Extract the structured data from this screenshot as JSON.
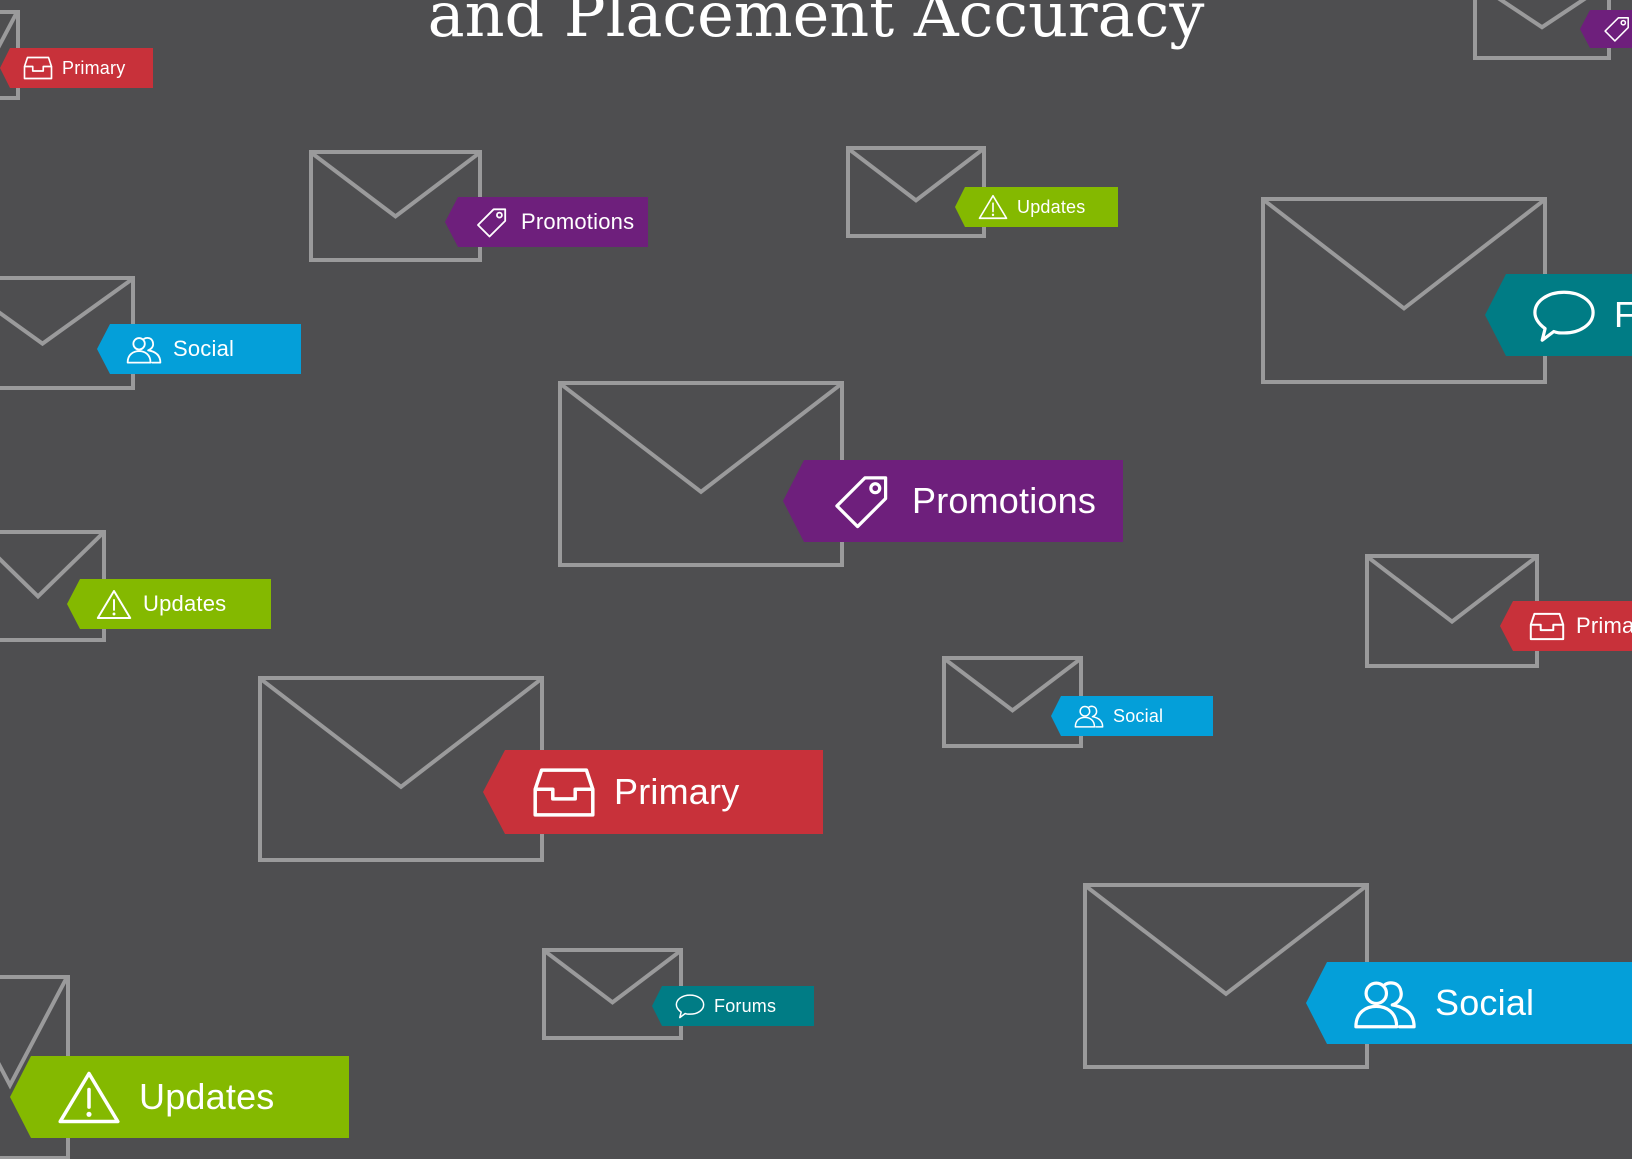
{
  "title": "and Placement Accuracy",
  "tag_colors": {
    "primary": "#c8313a",
    "promotions": "#6e1f7c",
    "updates": "#84b900",
    "social": "#049fd9",
    "forums": "#007c85"
  },
  "icon_names": {
    "primary": "inbox-tray-icon",
    "promotions": "price-tag-icon",
    "updates": "warning-triangle-icon",
    "social": "people-icon",
    "forums": "speech-bubble-icon"
  },
  "tags": [
    {
      "category": "primary",
      "label": "Primary"
    },
    {
      "category": "promotions",
      "label": "Promotions"
    },
    {
      "category": "updates",
      "label": "Updates"
    },
    {
      "category": "promotions",
      "label": ""
    },
    {
      "category": "social",
      "label": "Social"
    },
    {
      "category": "forums",
      "label": "F"
    },
    {
      "category": "promotions",
      "label": "Promotions"
    },
    {
      "category": "updates",
      "label": "Updates"
    },
    {
      "category": "primary",
      "label": "Prima"
    },
    {
      "category": "social",
      "label": "Social"
    },
    {
      "category": "primary",
      "label": "Primary"
    },
    {
      "category": "forums",
      "label": "Forums"
    },
    {
      "category": "social",
      "label": "Social"
    },
    {
      "category": "updates",
      "label": "Updates"
    }
  ]
}
